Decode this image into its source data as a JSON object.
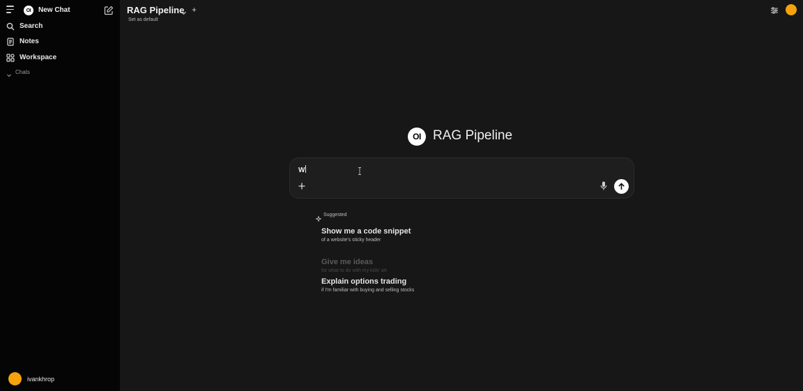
{
  "sidebar": {
    "new_chat_label": "New Chat",
    "logo_text": "OI",
    "items": [
      {
        "label": "Search",
        "icon": "search-icon"
      },
      {
        "label": "Notes",
        "icon": "notes-icon"
      },
      {
        "label": "Workspace",
        "icon": "workspace-icon"
      }
    ],
    "chats_label": "Chats",
    "user": {
      "name": "ivankhrop",
      "avatar_color": "#f5a20d"
    }
  },
  "header": {
    "model_name": "RAG Pipeline",
    "set_default_label": "Set as default",
    "add_label": "+"
  },
  "hero": {
    "logo_text": "OI",
    "title": "RAG Pipeline"
  },
  "composer": {
    "value": "W"
  },
  "suggested": {
    "label": "Suggested",
    "items": [
      {
        "title": "Show me a code snippet",
        "subtitle": "of a website's sticky header"
      },
      {
        "title": "Give me ideas",
        "subtitle": "for what to do with my kids' art"
      },
      {
        "title": "Explain options trading",
        "subtitle": "if I'm familiar with buying and selling stocks"
      }
    ]
  },
  "colors": {
    "accent": "#f5a20d",
    "background": "#171717",
    "sidebar_bg": "#050505"
  }
}
